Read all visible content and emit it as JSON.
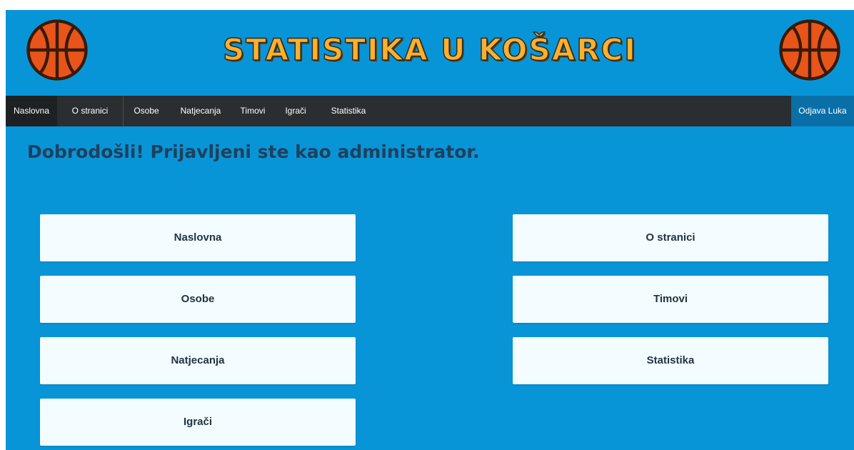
{
  "header": {
    "title": "STATISTIKA U KOŠARCI",
    "logo_icon": "basketball-icon",
    "accent_color": "#ffb02a",
    "background_color": "#0895d8"
  },
  "nav": {
    "items": [
      {
        "label": "Naslovna"
      },
      {
        "label": "O stranici"
      },
      {
        "label": "Osobe"
      },
      {
        "label": "Natjecanja"
      },
      {
        "label": "Timovi"
      },
      {
        "label": "Igrači"
      },
      {
        "label": "Statistika"
      }
    ],
    "logout_label": "Odjava Luka"
  },
  "main": {
    "welcome": "Dobrodošli! Prijavljeni ste kao administrator.",
    "tiles": [
      {
        "label": "Naslovna"
      },
      {
        "label": "O stranici"
      },
      {
        "label": "Osobe"
      },
      {
        "label": "Timovi"
      },
      {
        "label": "Natjecanja"
      },
      {
        "label": "Statistika"
      },
      {
        "label": "Igrači"
      }
    ]
  }
}
